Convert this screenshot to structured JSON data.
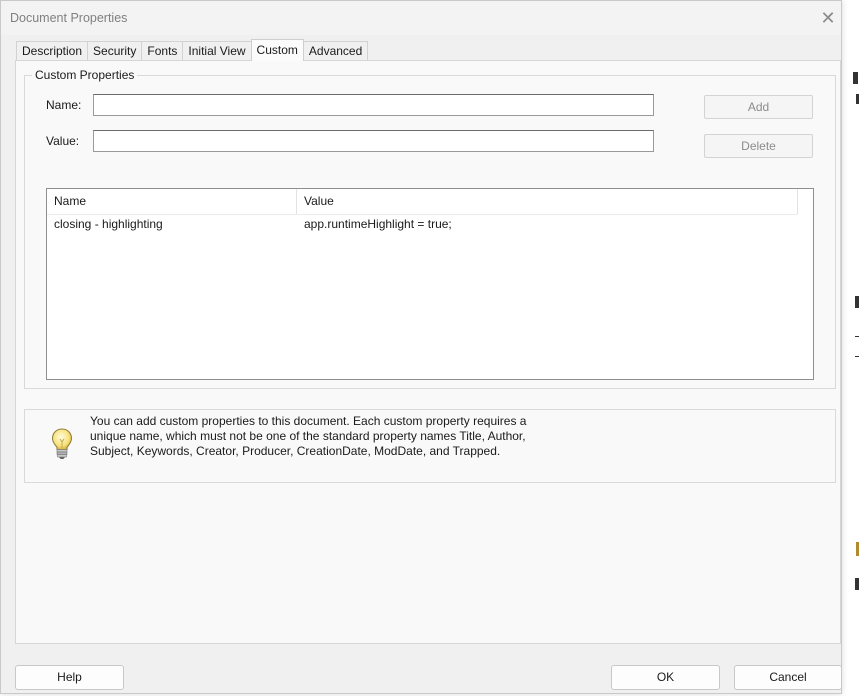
{
  "window": {
    "title": "Document Properties",
    "close_glyph": "✕"
  },
  "tabs": [
    {
      "label": "Description"
    },
    {
      "label": "Security"
    },
    {
      "label": "Fonts"
    },
    {
      "label": "Initial View"
    },
    {
      "label": "Custom",
      "active": true
    },
    {
      "label": "Advanced"
    }
  ],
  "custom_properties": {
    "group_label": "Custom Properties",
    "name_label": "Name:",
    "name_value": "",
    "value_label": "Value:",
    "value_value": "",
    "add_label": "Add",
    "delete_label": "Delete",
    "columns": {
      "name": "Name",
      "value": "Value"
    },
    "rows": [
      {
        "name": "closing - highlighting",
        "value": "app.runtimeHighlight = true;"
      }
    ]
  },
  "info": {
    "icon": "lightbulb-icon",
    "text": "You can add custom properties to this document. Each custom property requires a unique name, which must not be one of the standard property names Title, Author, Subject, Keywords, Creator, Producer, CreationDate, ModDate, and Trapped."
  },
  "footer": {
    "help_label": "Help",
    "ok_label": "OK",
    "cancel_label": "Cancel"
  }
}
